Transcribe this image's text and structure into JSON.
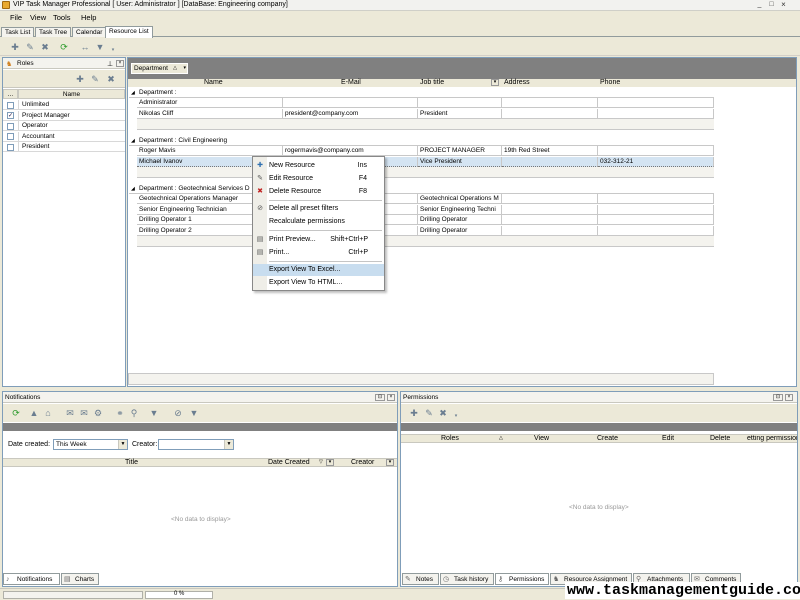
{
  "window": {
    "title": "VIP Task Manager Professional [ User: Administrator ] [DataBase: Engineering company]",
    "minimize": "_",
    "maximize": "□",
    "close": "×"
  },
  "menu": {
    "file": "File",
    "view": "View",
    "tools": "Tools",
    "help": "Help"
  },
  "tabs": [
    "Task List",
    "Task Tree",
    "Calendar",
    "Resource List"
  ],
  "roles": {
    "title": "Roles",
    "header_dots": "...",
    "header_name": "Name",
    "items": [
      {
        "name": "Unlimited",
        "checked": false
      },
      {
        "name": "Project Manager",
        "checked": true
      },
      {
        "name": "Operator",
        "checked": false
      },
      {
        "name": "Accountant",
        "checked": false
      },
      {
        "name": "President",
        "checked": false
      }
    ]
  },
  "grid": {
    "groupby_label": "Department",
    "columns": {
      "name": "Name",
      "email": "E-Mail",
      "job": "Job title",
      "address": "Address",
      "phone": "Phone"
    },
    "groups": [
      {
        "label": "Department :",
        "rows": [
          {
            "name": "Administrator",
            "email": "",
            "job": "",
            "address": "",
            "phone": ""
          },
          {
            "name": "Nikolas Cliff",
            "email": "president@company.com",
            "job": "President",
            "address": "",
            "phone": ""
          }
        ]
      },
      {
        "label": "Department : Civil Engineering",
        "rows": [
          {
            "name": "Roger Mavis",
            "email": "rogermavis@company.com",
            "job": "PROJECT MANAGER",
            "address": "19th Red Street",
            "phone": ""
          },
          {
            "name": "Michael Ivanov",
            "email": "",
            "job": "Vice President",
            "address": "",
            "phone": "032-312-21"
          }
        ]
      },
      {
        "label": "Department : Geotechnical Services D",
        "rows": [
          {
            "name": "Geotechnical Operations Manager",
            "email": "",
            "job": "Geotechnical Operations M",
            "address": "",
            "phone": ""
          },
          {
            "name": "Senior Engineering Technician",
            "email": "",
            "job": "Senior Engineering Techni",
            "address": "",
            "phone": ""
          },
          {
            "name": "Drilling Operator 1",
            "email": "",
            "job": "Drilling Operator",
            "address": "",
            "phone": ""
          },
          {
            "name": "Drilling Operator 2",
            "email": "",
            "job": "Drilling Operator",
            "address": "",
            "phone": ""
          }
        ]
      }
    ]
  },
  "context_menu": {
    "items": [
      {
        "label": "New Resource",
        "shortcut": "Ins"
      },
      {
        "label": "Edit Resource",
        "shortcut": "F4"
      },
      {
        "label": "Delete Resource",
        "shortcut": "F8"
      },
      {
        "label": "Delete all preset filters",
        "shortcut": ""
      },
      {
        "label": "Recalculate permissions",
        "shortcut": ""
      },
      {
        "label": "Print Preview...",
        "shortcut": "Shift+Ctrl+P"
      },
      {
        "label": "Print...",
        "shortcut": "Ctrl+P"
      },
      {
        "label": "Export View To Excel...",
        "shortcut": ""
      },
      {
        "label": "Export View To HTML...",
        "shortcut": ""
      }
    ],
    "highlighted_index": 7
  },
  "notifications": {
    "title": "Notifications",
    "date_created_label": "Date created:",
    "date_created_value": "This Week",
    "creator_label": "Creator:",
    "creator_value": "",
    "columns": {
      "title": "Title",
      "date_created": "Date Created",
      "creator": "Creator"
    },
    "no_data": "<No data to display>",
    "tabs": [
      "Notifications",
      "Charts"
    ]
  },
  "permissions": {
    "title": "Permissions",
    "columns": {
      "roles": "Roles",
      "view": "View",
      "create": "Create",
      "edit": "Edit",
      "delete": "Delete",
      "setting": "etting permission"
    },
    "no_data": "<No data to display>",
    "tabs": [
      "Notes",
      "Task history",
      "Permissions",
      "Resource Assignment",
      "Attachments",
      "Comments"
    ]
  },
  "status": {
    "progress_text": "0 %",
    "progress": 0
  },
  "watermark": "www.taskmanagementguide.com"
}
